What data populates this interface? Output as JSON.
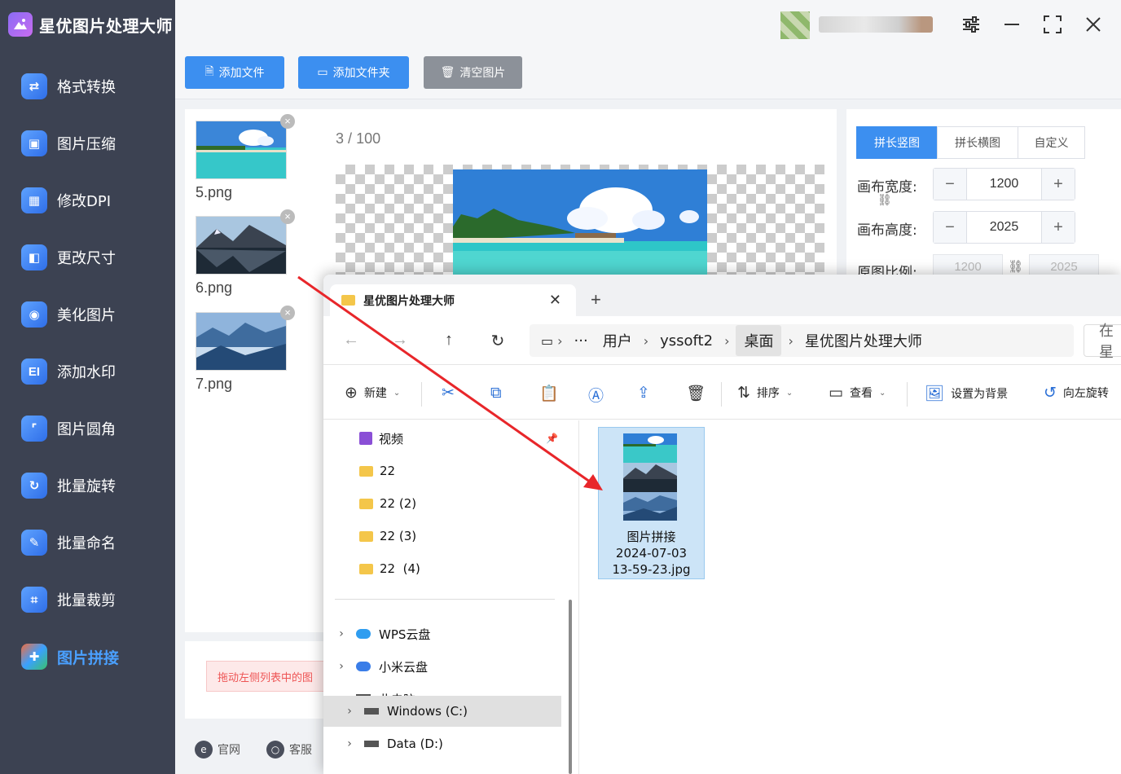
{
  "app": {
    "name": "星优图片处理大师",
    "colors": {
      "sidebar": "#3c4252",
      "accent": "#3c8ff0",
      "active_nav": "#4aa0ff",
      "hint_text": "#e55555"
    }
  },
  "sidebar": {
    "items": [
      {
        "label": "格式转换",
        "icon": "format-convert-icon"
      },
      {
        "label": "图片压缩",
        "icon": "compress-icon"
      },
      {
        "label": "修改DPI",
        "icon": "dpi-icon"
      },
      {
        "label": "更改尺寸",
        "icon": "resize-icon"
      },
      {
        "label": "美化图片",
        "icon": "beautify-icon"
      },
      {
        "label": "添加水印",
        "icon": "watermark-icon"
      },
      {
        "label": "图片圆角",
        "icon": "round-corner-icon"
      },
      {
        "label": "批量旋转",
        "icon": "rotate-icon"
      },
      {
        "label": "批量命名",
        "icon": "rename-icon"
      },
      {
        "label": "批量裁剪",
        "icon": "crop-icon"
      },
      {
        "label": "图片拼接",
        "icon": "stitch-icon",
        "active": true
      }
    ]
  },
  "toolbar": {
    "add_file": "添加文件",
    "add_folder": "添加文件夹",
    "clear": "清空图片"
  },
  "files": [
    {
      "name": "5.png",
      "thumb": "beach-thumbnail"
    },
    {
      "name": "6.png",
      "thumb": "mountain-lake-thumbnail"
    },
    {
      "name": "7.png",
      "thumb": "blue-mountains-thumbnail"
    }
  ],
  "preview": {
    "current": "3",
    "separator": "/",
    "total": "100"
  },
  "settings": {
    "tabs": [
      "拼长竖图",
      "拼长横图",
      "自定义"
    ],
    "active_tab": 0,
    "width_label": "画布宽度:",
    "width_value": "1200",
    "height_label": "画布高度:",
    "height_value": "2025",
    "ratio_label": "原图比例:",
    "ratio_width": "1200",
    "ratio_height": "2025"
  },
  "hint": "拖动左侧列表中的图",
  "footer": {
    "website": "官网",
    "service": "客服"
  },
  "explorer": {
    "tab_title": "星优图片处理大师",
    "breadcrumb": [
      "用户",
      "yssoft2",
      "桌面",
      "星优图片处理大师"
    ],
    "ellipsis": "···",
    "search_placeholder": "在 星",
    "commands": {
      "new": "新建",
      "sort": "排序",
      "view": "查看",
      "set_bg": "设置为背景",
      "rotate_left": "向左旋转"
    },
    "tree": [
      {
        "label": "视频",
        "icon": "video-folder-icon"
      },
      {
        "label": "22",
        "icon": "folder-icon"
      },
      {
        "label": "22 (2)",
        "icon": "folder-icon"
      },
      {
        "label": "22 (3)",
        "icon": "folder-icon"
      },
      {
        "label": "22  (4)",
        "icon": "folder-icon"
      },
      {
        "label": "WPS云盘",
        "icon": "wps-cloud-icon"
      },
      {
        "label": "小米云盘",
        "icon": "xiaomi-cloud-icon"
      },
      {
        "label": "此电脑",
        "icon": "computer-icon"
      },
      {
        "label": "Windows (C:)",
        "icon": "drive-icon"
      },
      {
        "label": "Data (D:)",
        "icon": "drive-icon"
      }
    ],
    "file": {
      "line1": "图片拼接",
      "line2": "2024-07-03",
      "line3": "13-59-23.jpg"
    }
  }
}
